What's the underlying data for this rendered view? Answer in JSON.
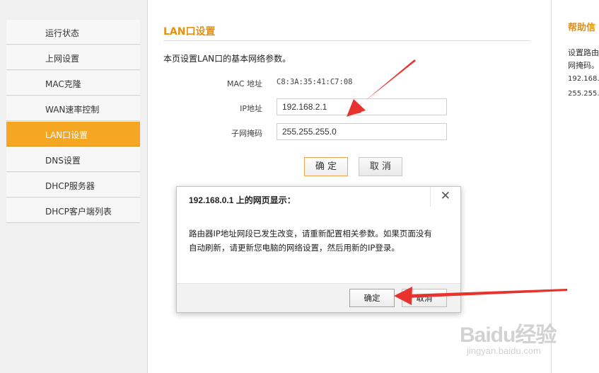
{
  "sidebar": {
    "items": [
      {
        "label": "运行状态"
      },
      {
        "label": "上网设置"
      },
      {
        "label": "MAC克隆"
      },
      {
        "label": "WAN速率控制"
      },
      {
        "label": "LAN口设置"
      },
      {
        "label": "DNS设置"
      },
      {
        "label": "DHCP服务器"
      },
      {
        "label": "DHCP客户端列表"
      }
    ],
    "active_index": 4
  },
  "main": {
    "title": "LAN口设置",
    "description": "本页设置LAN口的基本网络参数。",
    "mac_label": "MAC 地址",
    "mac_value": "C8:3A:35:41:C7:08",
    "ip_label": "IP地址",
    "ip_value": "192.168.2.1",
    "mask_label": "子网掩码",
    "mask_value": "255.255.255.0",
    "ok_label": "确 定",
    "cancel_label": "取 消"
  },
  "help": {
    "title": "帮助信",
    "lines": [
      "设置路由",
      "网掩码。",
      "192.168.",
      "255.255."
    ]
  },
  "dialog": {
    "title": "192.168.0.1 上的网页显示：",
    "close_glyph": "✕",
    "message_line1": "路由器IP地址网段已发生改变，请重新配置相关参数。如果页面没有",
    "message_line2": "自动刷新，请更新您电脑的网络设置，然后用新的IP登录。",
    "ok_label": "确定",
    "cancel_label": "取消"
  },
  "watermark": {
    "brand": "Baidu经验",
    "url": "jingyan.baidu.com"
  },
  "colors": {
    "accent": "#f5a623",
    "title_orange": "#e6900f",
    "arrow_red": "#e8322d"
  }
}
